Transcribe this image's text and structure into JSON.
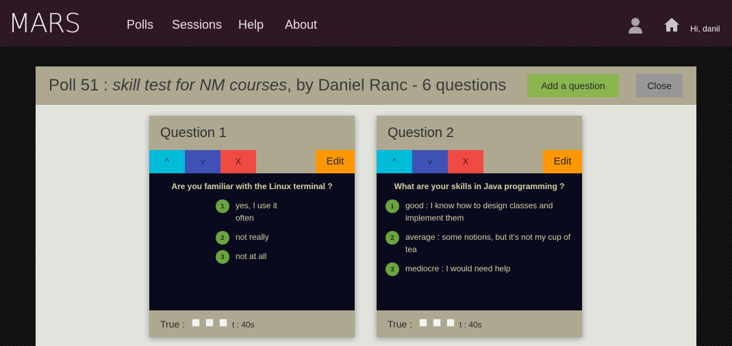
{
  "navbar": {
    "brand": "MARS",
    "links": [
      "Polls",
      "Sessions",
      "Help",
      "About"
    ],
    "icons": {
      "user": "user-icon",
      "home": "home-icon"
    },
    "greeting": "Hi, danil"
  },
  "poll": {
    "prefix": "Poll 51 : ",
    "name": "skill test for NM courses",
    "suffix": ", by Daniel Ranc - 6 questions",
    "add_button": "Add a question",
    "close_button": "Close"
  },
  "questions": [
    {
      "title": "Question 1",
      "controls": {
        "up": "^",
        "down": "v",
        "delete": "X",
        "edit": "Edit"
      },
      "text": "Are you familiar with the Linux terminal ?",
      "answers": [
        {
          "num": "1",
          "text": "yes, I use it often"
        },
        {
          "num": "2",
          "text": "not really"
        },
        {
          "num": "3",
          "text": "not at all"
        }
      ],
      "true_label": "True :",
      "time": "t : 40s"
    },
    {
      "title": "Question 2",
      "controls": {
        "up": "^",
        "down": "v",
        "delete": "X",
        "edit": "Edit"
      },
      "text": "What are your skills in Java programming ?",
      "answers": [
        {
          "num": "1",
          "text": "good : I know how to design classes and implement them"
        },
        {
          "num": "2",
          "text": "average : some notions, but it's not my cup of tea"
        },
        {
          "num": "3",
          "text": "mediocre : I would need help"
        }
      ],
      "true_label": "True :",
      "time": "t : 40s"
    }
  ],
  "colors": {
    "navbar": "#2e1824",
    "panel_header": "#aea891",
    "add_button": "#8ab54f",
    "close_button": "#979797",
    "up": "#00bcd8",
    "down": "#3f51b5",
    "delete": "#ef4b43",
    "edit": "#ff9800",
    "answer_badge": "#6aa43f",
    "card_body": "#0a0a1e"
  }
}
